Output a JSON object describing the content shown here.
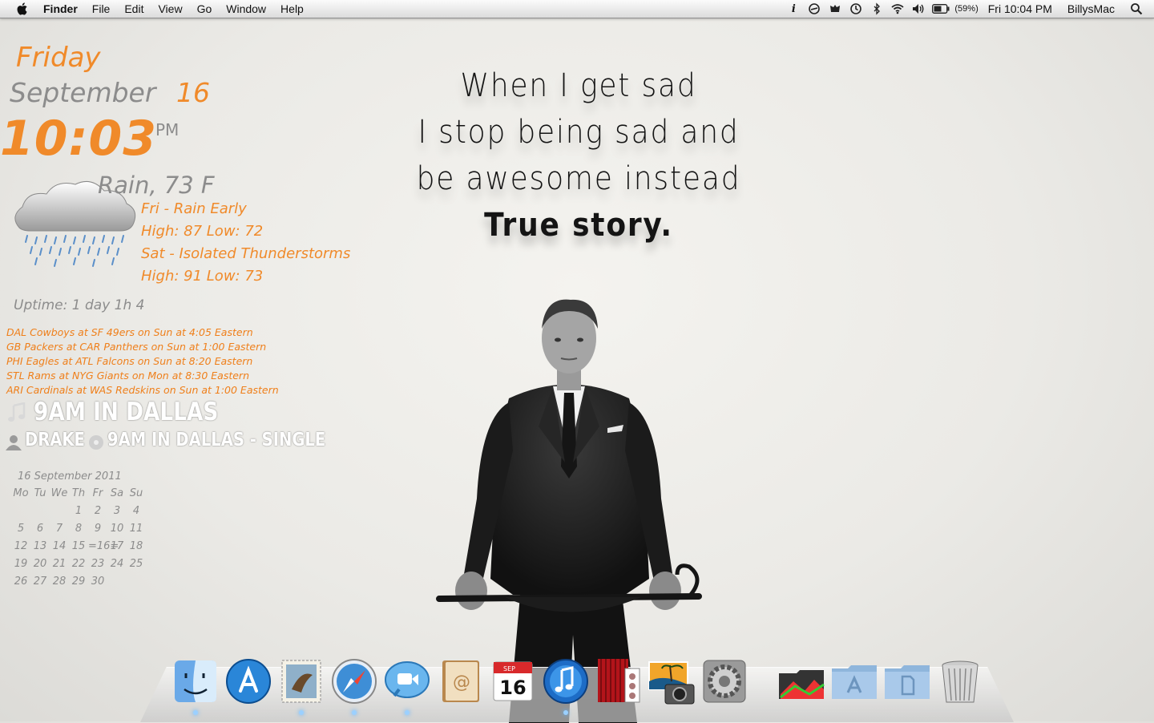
{
  "menubar": {
    "app_name": "Finder",
    "menus": [
      "File",
      "Edit",
      "View",
      "Go",
      "Window",
      "Help"
    ],
    "battery_percent": "(59%)",
    "clock": "Fri 10:04 PM",
    "user": "BillysMac",
    "status_icons": [
      "info-icon",
      "sync-icon",
      "growl-icon",
      "time-machine-icon",
      "bluetooth-icon",
      "wifi-icon",
      "volume-icon",
      "battery-icon",
      "spotlight-icon"
    ]
  },
  "quote": {
    "line1": "When I get sad",
    "line2": "I stop being sad and",
    "line3": "be awesome instead",
    "line4": "True story."
  },
  "clock_widget": {
    "day": "Friday",
    "month": "September",
    "date": "16",
    "time": "10:03",
    "ampm": "PM"
  },
  "weather": {
    "condition": "Rain, 73 F",
    "forecast": [
      {
        "label": "Fri - Rain Early",
        "temps": "High: 87 Low: 72"
      },
      {
        "label": "Sat - Isolated Thunderstorms",
        "temps": "High: 91 Low: 73"
      }
    ]
  },
  "uptime": "Uptime: 1 day 1h 4",
  "games": [
    "DAL Cowboys at SF 49ers on Sun at 4:05 Eastern",
    "GB Packers at CAR Panthers on Sun at 1:00 Eastern",
    "PHI Eagles at ATL Falcons on Sun at 8:20 Eastern",
    "STL Rams at NYG Giants on Mon at 8:30 Eastern",
    "ARI Cardinals at WAS Redskins on Sun at 1:00 Eastern"
  ],
  "now_playing": {
    "track": "9AM IN DALLAS",
    "artist": "DRAKE",
    "album": "9AM IN DALLAS - SINGLE"
  },
  "calendar": {
    "title": "16 September 2011",
    "weekdays": [
      "Mo",
      "Tu",
      "We",
      "Th",
      "Fr",
      "Sa",
      "Su"
    ],
    "rows": [
      [
        "",
        "",
        "",
        "1",
        "2",
        "3",
        "4"
      ],
      [
        "5",
        "6",
        "7",
        "8",
        "9",
        "10",
        "11"
      ],
      [
        "12",
        "13",
        "14",
        "15",
        "=16=",
        "17",
        "18"
      ],
      [
        "19",
        "20",
        "21",
        "22",
        "23",
        "24",
        "25"
      ],
      [
        "26",
        "27",
        "28",
        "29",
        "30",
        "",
        ""
      ]
    ]
  },
  "dock": {
    "apps": [
      "finder",
      "app-store",
      "mail",
      "safari",
      "facetime",
      "address-book",
      "ical",
      "itunes",
      "photo-booth",
      "iphoto",
      "system-preferences"
    ],
    "folders": [
      "downloads-stack",
      "applications-folder",
      "documents-folder",
      "trash"
    ],
    "calendar_icon_month": "SEP",
    "calendar_icon_day": "16"
  },
  "colors": {
    "accent_orange": "#f08a2a",
    "widget_gray": "#8c8c8c"
  }
}
